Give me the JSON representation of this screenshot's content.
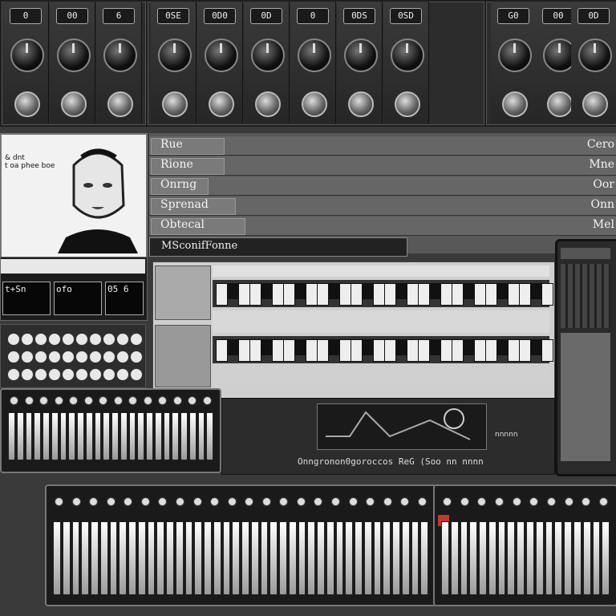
{
  "channels": [
    {
      "label": "0"
    },
    {
      "label": "00"
    },
    {
      "label": "6"
    },
    {
      "label": "0SE"
    },
    {
      "label": "0D0"
    },
    {
      "label": "0D"
    },
    {
      "label": "0"
    },
    {
      "label": "0DS"
    },
    {
      "label": "0SD"
    },
    {
      "label": "G0"
    },
    {
      "label": "00"
    },
    {
      "label": "0D"
    }
  ],
  "video": {
    "caption": "& dnt\nt oa phee boe"
  },
  "tracks": [
    {
      "name": "Rue",
      "alt": "Cero"
    },
    {
      "name": "Rione",
      "alt": "Mne"
    },
    {
      "name": "Onrng",
      "alt": "Oor"
    },
    {
      "name": "Sprenad",
      "alt": "Onn"
    },
    {
      "name": "Obtecal",
      "alt": "Mel"
    }
  ],
  "section_title": "MSconifFonne",
  "readouts": [
    "t+Sn",
    "ofo",
    "05 6"
  ],
  "plugin": {
    "title": "Onngronon0goroccos ReG (Soo nn nnnn"
  },
  "plugin_side": "nnnnn",
  "colors": {
    "accent": "#c0392b",
    "panel": "#2c2c2c"
  }
}
